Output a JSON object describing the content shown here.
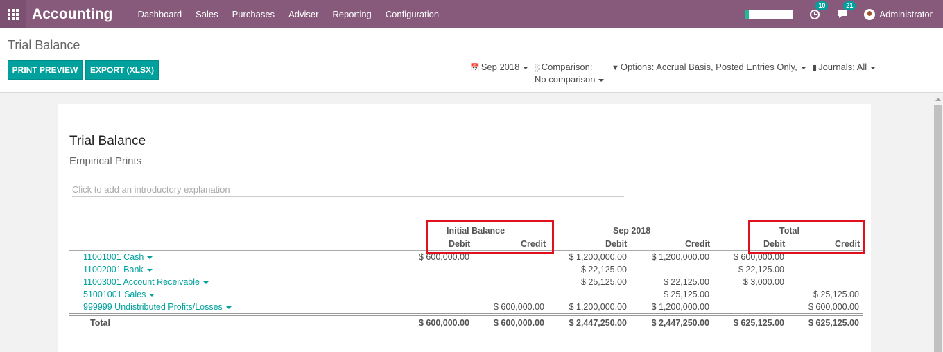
{
  "app": {
    "brand": "Accounting",
    "menu": [
      "Dashboard",
      "Sales",
      "Purchases",
      "Adviser",
      "Reporting",
      "Configuration"
    ],
    "progress_fraction": 0.08,
    "activity_count": "10",
    "messages_count": "21",
    "user": "Administrator"
  },
  "control": {
    "breadcrumb": "Trial Balance",
    "print_label": "PRINT PREVIEW",
    "export_label": "EXPORT (XLSX)",
    "date_filter": "Sep 2018",
    "comparison_label": "Comparison:",
    "comparison_value": "No comparison",
    "options_label": "Options: Accrual Basis, Posted Entries Only,",
    "journals_label": "Journals: All"
  },
  "report": {
    "title": "Trial Balance",
    "company": "Empirical Prints",
    "intro_placeholder": "Click to add an introductory explanation",
    "groups": [
      "Initial Balance",
      "Sep 2018",
      "Total"
    ],
    "subheaders": [
      "Debit",
      "Credit",
      "Debit",
      "Credit",
      "Debit",
      "Credit"
    ],
    "rows": [
      {
        "account": "11001001 Cash",
        "values": [
          "$ 600,000.00",
          "",
          "$ 1,200,000.00",
          "$ 1,200,000.00",
          "$ 600,000.00",
          ""
        ]
      },
      {
        "account": "11002001 Bank",
        "values": [
          "",
          "",
          "$ 22,125.00",
          "",
          "$ 22,125.00",
          ""
        ]
      },
      {
        "account": "11003001 Account Receivable",
        "values": [
          "",
          "",
          "$ 25,125.00",
          "$ 22,125.00",
          "$ 3,000.00",
          ""
        ]
      },
      {
        "account": "51001001 Sales",
        "values": [
          "",
          "",
          "",
          "$ 25,125.00",
          "",
          "$ 25,125.00"
        ]
      },
      {
        "account": "999999 Undistributed Profits/Losses",
        "values": [
          "",
          "$ 600,000.00",
          "$ 1,200,000.00",
          "$ 1,200,000.00",
          "",
          "$ 600,000.00"
        ]
      }
    ],
    "total": {
      "label": "Total",
      "values": [
        "$ 600,000.00",
        "$ 600,000.00",
        "$ 2,447,250.00",
        "$ 2,447,250.00",
        "$ 625,125.00",
        "$ 625,125.00"
      ]
    }
  },
  "colors": {
    "navbar": "#875a7b",
    "primary_button": "#00a09d",
    "highlight_box": "#e0111c"
  }
}
